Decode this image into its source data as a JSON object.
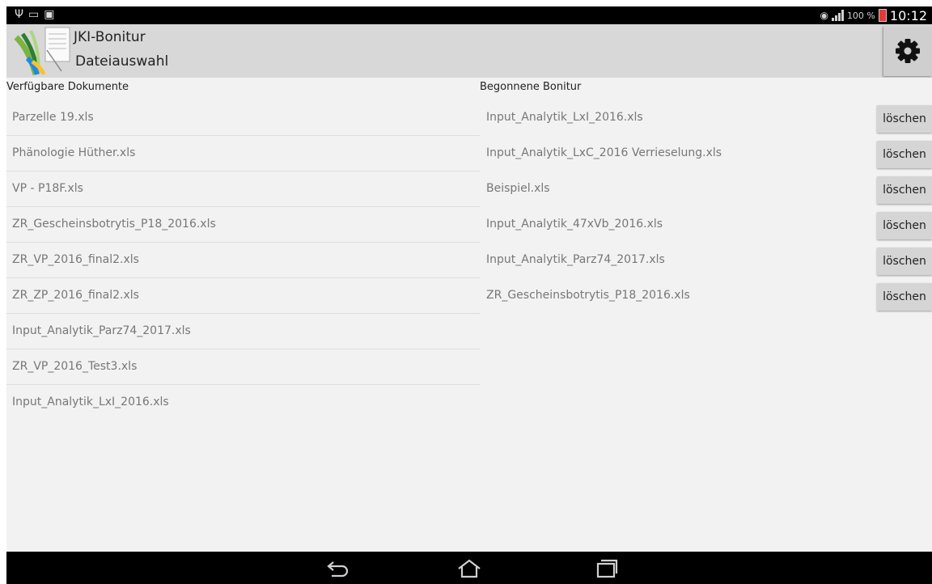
{
  "statusbar": {
    "left_icons": [
      "usb-icon",
      "screen-cast-icon",
      "sim-icon"
    ],
    "battery_percent": "100 %",
    "time": "10:12"
  },
  "app": {
    "title": "JKI-Bonitur",
    "subtitle": "Dateiauswahl",
    "settings_icon": "gear-icon"
  },
  "available": {
    "header": "Verfügbare Dokumente",
    "items": [
      "Parzelle 19.xls",
      "Phänologie Hüther.xls",
      "VP - P18F.xls",
      "ZR_Gescheinsbotrytis_P18_2016.xls",
      "ZR_VP_2016_final2.xls",
      "ZR_ZP_2016_final2.xls",
      "Input_Analytik_Parz74_2017.xls",
      "ZR_VP_2016_Test3.xls",
      "Input_Analytik_LxI_2016.xls"
    ]
  },
  "started": {
    "header": "Begonnene Bonitur",
    "delete_label": "löschen",
    "items": [
      "Input_Analytik_LxI_2016.xls",
      "Input_Analytik_LxC_2016 Verrieselung.xls",
      "Beispiel.xls",
      "Input_Analytik_47xVb_2016.xls",
      "Input_Analytik_Parz74_2017.xls",
      "ZR_Gescheinsbotrytis_P18_2016.xls"
    ]
  },
  "navbar": {
    "buttons": [
      "back-icon",
      "home-icon",
      "recent-apps-icon"
    ]
  },
  "colors": {
    "actionbar": "#d8d8d8",
    "content_bg": "#f2f2f2",
    "button_bg": "#d5d5d5",
    "item_text": "#777777",
    "battery": "#e53935"
  }
}
